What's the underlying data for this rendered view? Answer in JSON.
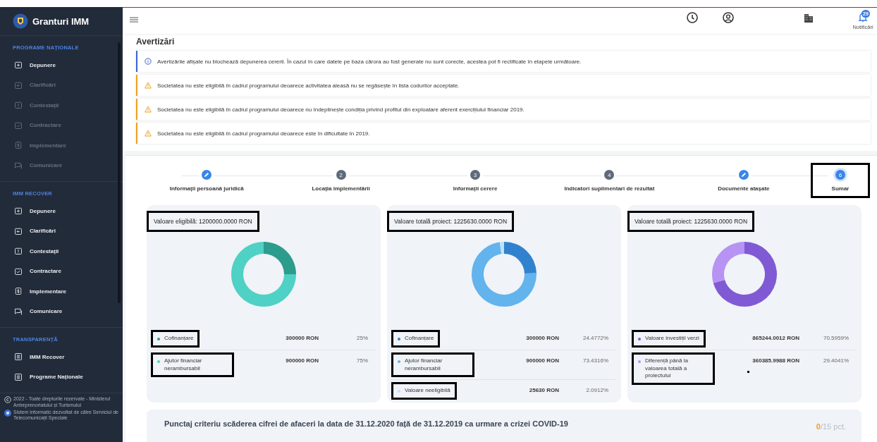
{
  "sidebar": {
    "brand": "Granturi IMM",
    "sections": [
      {
        "title": "PROGRAME NAȚIONALE",
        "items": [
          {
            "label": "Depunere",
            "disabled": false
          },
          {
            "label": "Clarificări",
            "disabled": true
          },
          {
            "label": "Contestații",
            "disabled": true
          },
          {
            "label": "Contractare",
            "disabled": true
          },
          {
            "label": "Implementare",
            "disabled": true
          },
          {
            "label": "Comunicare",
            "disabled": true
          }
        ]
      },
      {
        "title": "IMM RECOVER",
        "items": [
          {
            "label": "Depunere",
            "disabled": false
          },
          {
            "label": "Clarificări",
            "disabled": false
          },
          {
            "label": "Contestații",
            "disabled": false
          },
          {
            "label": "Contractare",
            "disabled": false
          },
          {
            "label": "Implementare",
            "disabled": false
          },
          {
            "label": "Comunicare",
            "disabled": false
          }
        ]
      },
      {
        "title": "TRANSPARENȚĂ",
        "items": [
          {
            "label": "IMM Recover",
            "disabled": false
          },
          {
            "label": "Programe Naționale",
            "disabled": false
          }
        ]
      }
    ],
    "footer": {
      "copyright": "2022 - Toate drepturile rezervate - Ministerul Antreprenoriatului și Turismului",
      "developer": "Sistem informatic dezvoltat de către Serviciul de Telecomunicații Speciale"
    }
  },
  "header": {
    "notifications": {
      "count": "29",
      "label": "Notificări"
    }
  },
  "warnings": {
    "title": "Avertizări",
    "items": [
      {
        "kind": "info",
        "text": "Avertizările afișate nu blochează depunerea cererii. În cazul în care datele pe baza cărora au fost generate nu sunt corecte, acestea pot fi rectificate în etapele următoare."
      },
      {
        "kind": "warning",
        "text": "Societatea nu este eligibilă în cadrul programului deoarece activitatea aleasă nu se regăsește în lista codurilor acceptate."
      },
      {
        "kind": "warning",
        "text": "Societatea nu este eligibilă în cadrul programului deoarece nu îndeplinește condiția privind profitul din exploatare aferent exercițiului financiar 2019."
      },
      {
        "kind": "warning",
        "text": "Societatea nu este eligibilă în cadrul programului deoarece este în dificultate în 2019."
      }
    ]
  },
  "steps": [
    {
      "kind": "done",
      "label": "Informații persoană juridică",
      "selected": false,
      "highlighted": false
    },
    {
      "kind": "number",
      "number": "2",
      "label": "Locația implementării",
      "selected": false,
      "highlighted": false
    },
    {
      "kind": "number",
      "number": "3",
      "label": "Informații cerere",
      "selected": false,
      "highlighted": false
    },
    {
      "kind": "number",
      "number": "4",
      "label": "Indicatori suplimentari de rezultat",
      "selected": false,
      "highlighted": false
    },
    {
      "kind": "done",
      "label": "Documente atașate",
      "selected": false,
      "highlighted": false
    },
    {
      "kind": "number",
      "number": "6",
      "label": "Sumar",
      "selected": true,
      "highlighted": true
    }
  ],
  "cards": [
    {
      "title": "Valoare eligibilă: 1200000.0000 RON",
      "title_highlighted": true,
      "chart_data": {
        "type": "donut",
        "categories": [
          "Cofinanțare",
          "Ajutor financiar nerambursabil"
        ],
        "values": [
          25,
          75
        ]
      },
      "legend": [
        {
          "amount": "300000 RON",
          "percent": "25%",
          "color": "#2c9c8c",
          "highlighted": true
        },
        {
          "amount": "900000 RON",
          "percent": "75%",
          "color": "#4fd1c5",
          "highlighted": true
        }
      ]
    },
    {
      "title": "Valoare totală proiect: 1225630.0000 RON",
      "title_highlighted": true,
      "chart_data": {
        "type": "donut",
        "categories": [
          "Cofinanțare",
          "Ajutor financiar nerambursabil",
          "Valoare neeligibilă"
        ],
        "values": [
          24.4772,
          73.4316,
          2.0912
        ]
      },
      "legend": [
        {
          "amount": "300000 RON",
          "percent": "24.4772%",
          "color": "#3182ce",
          "highlighted": true
        },
        {
          "amount": "900000 RON",
          "percent": "73.4316%",
          "color": "#63b3ed",
          "highlighted": true
        },
        {
          "amount": "25630 RON",
          "percent": "2.0912%",
          "color": "#bee3f8",
          "highlighted": true
        }
      ]
    },
    {
      "title": "Valoare totală proiect: 1225630.0000 RON",
      "title_highlighted": true,
      "chart_data": {
        "type": "donut",
        "categories": [
          "Valoare investiții verzi",
          "Diferență până la valoarea totală a proiectului"
        ],
        "values": [
          70.5959,
          29.4041
        ]
      },
      "legend": [
        {
          "amount": "865244.0012 RON",
          "percent": "70.5959%",
          "color": "#805ad5",
          "highlighted": true
        },
        {
          "amount": "360385.9988 RON",
          "percent": "29.4041%",
          "color": "#b794f4",
          "highlighted": true
        }
      ]
    }
  ],
  "score": {
    "text": "Punctaj criteriu scăderea cifrei de afaceri la data de 31.12.2020 față de 31.12.2019 ca urmare a crizei COVID-19",
    "value": "0",
    "max": "/15 pct."
  }
}
